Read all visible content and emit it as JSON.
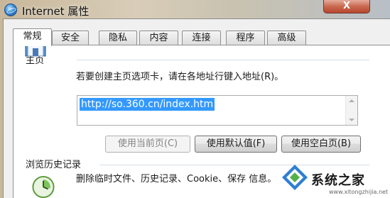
{
  "window": {
    "title": "Internet 属性",
    "close_label": "X"
  },
  "tabs": [
    {
      "label": "常规",
      "active": true
    },
    {
      "label": "安全"
    },
    {
      "label": "隐私"
    },
    {
      "label": "内容"
    },
    {
      "label": "连接"
    },
    {
      "label": "程序"
    },
    {
      "label": "高级"
    }
  ],
  "home_page": {
    "section_title": "主页",
    "instruction": "若要创建主页选项卡，请在各地址行键入地址(R)。",
    "address_value": "http://so.360.cn/index.htm",
    "buttons": {
      "use_current": "使用当前页(C)",
      "use_default": "使用默认值(F)",
      "use_blank": "使用空白页(B)"
    }
  },
  "history": {
    "section_title": "浏览历史记录",
    "text": "删除临时文件、历史记录、Cookie、保存 信息。"
  },
  "watermark": {
    "text": "系统之家",
    "url": "www.xitongzhijia.net"
  },
  "colors": {
    "selection": "#3399ff",
    "close_button": "#c8674e"
  }
}
